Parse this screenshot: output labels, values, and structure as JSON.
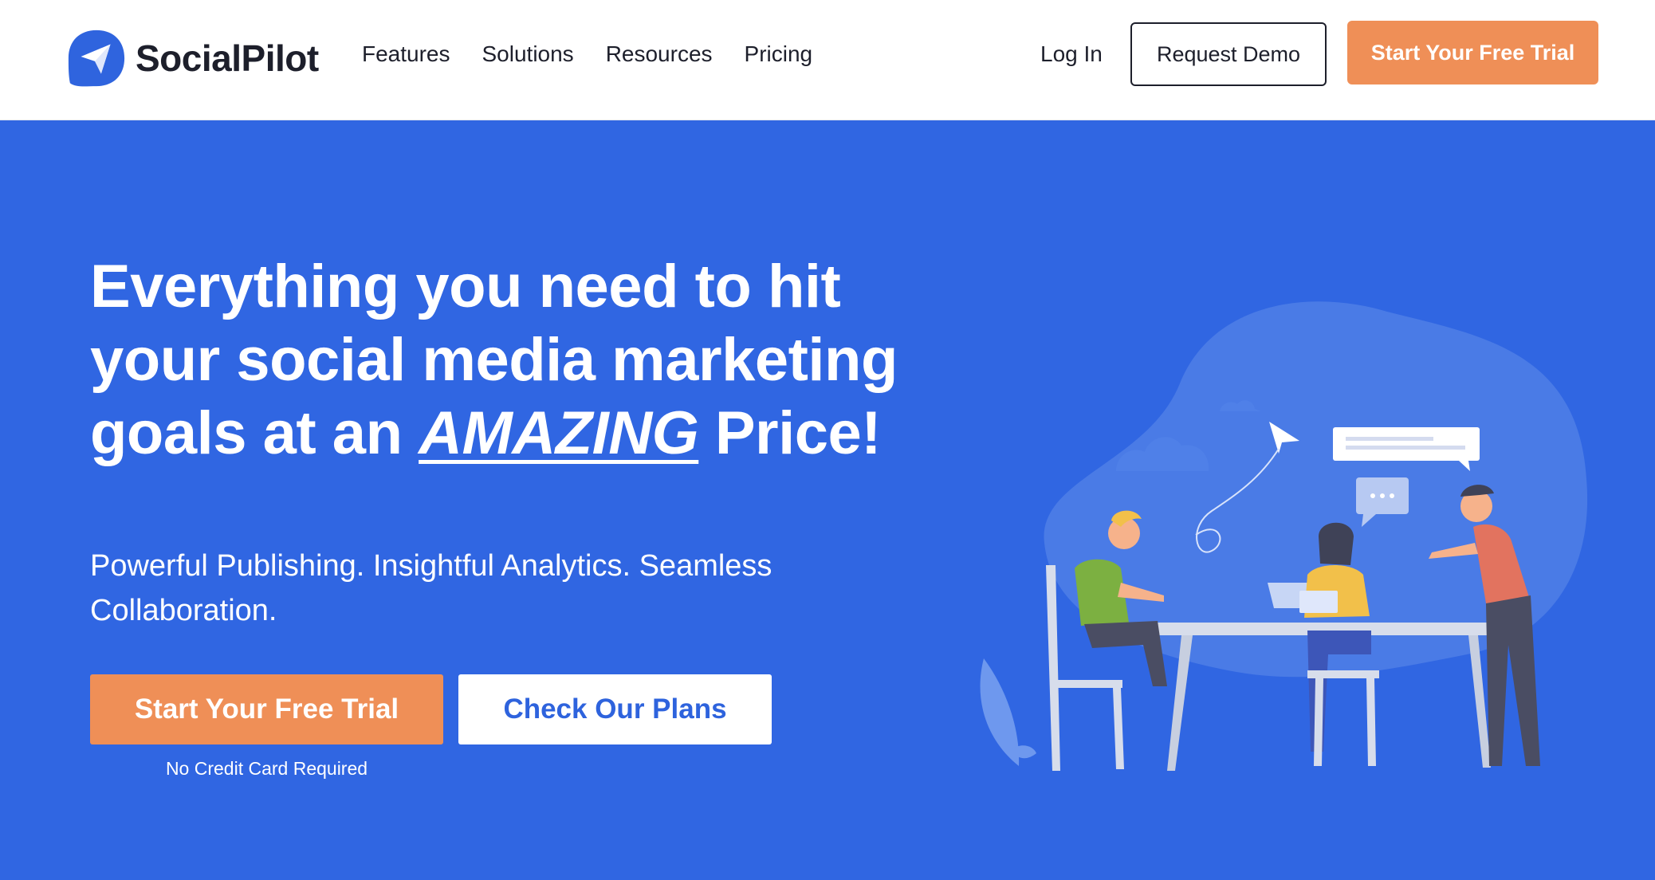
{
  "brand": {
    "name": "SocialPilot",
    "color": "#3066e2"
  },
  "nav": {
    "items": [
      {
        "label": "Features"
      },
      {
        "label": "Solutions"
      },
      {
        "label": "Resources"
      },
      {
        "label": "Pricing"
      }
    ],
    "login_label": "Log In",
    "demo_label": "Request Demo",
    "trial_label": "Start Your Free Trial"
  },
  "hero": {
    "headline_part1": "Everything you need to hit your social media marketing goals at an ",
    "headline_emphasis": "AMAZING",
    "headline_part2": " Price!",
    "subline": "Powerful Publishing. Insightful Analytics. Seamless Collaboration.",
    "primary_cta": "Start Your Free Trial",
    "secondary_cta": "Check Our Plans",
    "cta_note": "No Credit Card Required",
    "illustration": "team-meeting-illustration"
  },
  "colors": {
    "hero_bg": "#3066e2",
    "accent_orange": "#ef8f57",
    "text_dark": "#1d1f2b",
    "white": "#ffffff"
  },
  "icons": {
    "logo": "paper-plane-logo-icon"
  }
}
